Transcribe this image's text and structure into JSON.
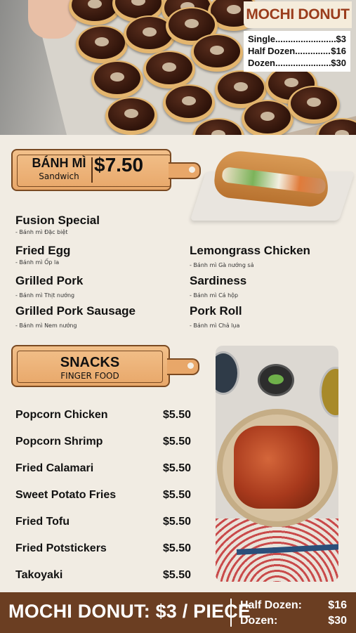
{
  "header": {
    "title": "MOCHI DONUT",
    "prices": [
      {
        "label": "Single",
        "price": "$3"
      },
      {
        "label": "Half Dozen",
        "price": "$16"
      },
      {
        "label": "Dozen",
        "price": "$30"
      }
    ]
  },
  "banh_mi": {
    "name": "BÁNH MÌ",
    "subtitle": "Sandwich",
    "price": "$7.50",
    "items": [
      {
        "name": "Fusion Special",
        "viet": "- Bánh mì Đặc biệt"
      },
      {
        "name": "Fried Egg",
        "viet": "- Bánh mì Ốp la"
      },
      {
        "name": "Grilled Pork",
        "viet": "- Bánh mì Thịt nướng"
      },
      {
        "name": "Grilled Pork Sausage",
        "viet": "- Bánh mì Nem nướng"
      },
      {
        "name": "Lemongrass Chicken",
        "viet": "- Bánh mì Gà nướng sả"
      },
      {
        "name": "Sardiness",
        "viet": "- Bánh mì Cá hộp"
      },
      {
        "name": "Pork Roll",
        "viet": "- Bánh mì Chả lụa"
      }
    ]
  },
  "snacks": {
    "title": "SNACKS",
    "subtitle": "FINGER FOOD",
    "items": [
      {
        "name": "Popcorn Chicken",
        "price": "$5.50"
      },
      {
        "name": "Popcorn Shrimp",
        "price": "$5.50"
      },
      {
        "name": "Fried Calamari",
        "price": "$5.50"
      },
      {
        "name": "Sweet Potato Fries",
        "price": "$5.50"
      },
      {
        "name": "Fried Tofu",
        "price": "$5.50"
      },
      {
        "name": "Fried Potstickers",
        "price": "$5.50"
      },
      {
        "name": "Takoyaki",
        "price": "$5.50"
      }
    ]
  },
  "footer": {
    "main": "MOCHI DONUT: $3 / PIECE",
    "half_label": "Half Dozen:",
    "half_price": "$16",
    "dozen_label": "Dozen:",
    "dozen_price": "$30"
  },
  "colors": {
    "brand": "#9a3c1c",
    "board": "#e8a769",
    "footer": "#6b3e22",
    "background": "#f1ece3"
  }
}
